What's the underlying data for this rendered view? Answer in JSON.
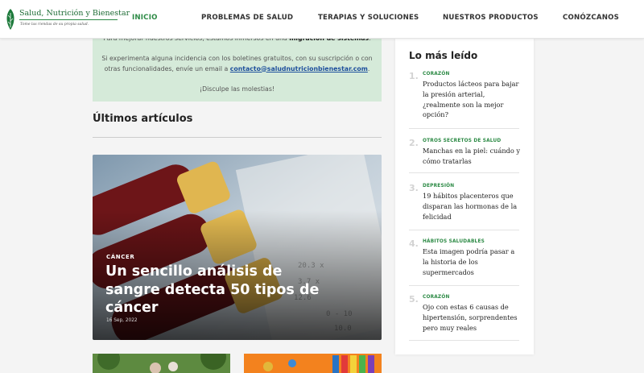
{
  "header": {
    "logo_title": "Salud, Nutrición y Bienestar",
    "logo_tagline": "Tome las riendas de su propia salud.",
    "nav": [
      {
        "label": "INICIO",
        "active": true
      },
      {
        "label": "PROBLEMAS DE SALUD",
        "active": false
      },
      {
        "label": "TERAPIAS Y SOLUCIONES",
        "active": false
      },
      {
        "label": "NUESTROS PRODUCTOS",
        "active": false
      },
      {
        "label": "CONÓZCANOS",
        "active": false
      }
    ]
  },
  "notice": {
    "line1_start": "Para mejorar nuestros servicios, estamos inmersos en una ",
    "line1_bold": "migración de sistemas",
    "line1_end": ".",
    "line2": "Si experimenta alguna incidencia con los boletines gratuitos, con su suscripción o con otras funcionalidades, envíe un email a ",
    "email": "contacto@saludnutricionbienestar.com",
    "line2_end": ".",
    "line3": "¡Disculpe las molestias!"
  },
  "latest": {
    "section_title": "Últimos artículos",
    "featured": {
      "category": "CÁNCER",
      "title": "Un sencillo análisis de sangre detecta 50 tipos de cáncer",
      "date": "16 Sep, 2022"
    }
  },
  "sidebar": {
    "title": "Lo más leído",
    "items": [
      {
        "num": "1.",
        "category": "CORAZÓN",
        "title": "Productos lácteos para bajar la presión arterial, ¿realmente son la mejor opción?"
      },
      {
        "num": "2.",
        "category": "OTROS SECRETOS DE SALUD",
        "title": "Manchas en la piel: cuándo y cómo tratarlas"
      },
      {
        "num": "3.",
        "category": "DEPRESIÓN",
        "title": "19 hábitos placenteros que disparan las hormonas de la felicidad"
      },
      {
        "num": "4.",
        "category": "HÁBITOS SALUDABLES",
        "title": "Esta imagen podría pasar a la historia de los supermercados"
      },
      {
        "num": "5.",
        "category": "CORAZÓN",
        "title": "Ojo con estas 6 causas de hipertensión, sorprendentes pero muy reales"
      }
    ]
  },
  "colors": {
    "accent": "#2c8a45",
    "notice_bg": "#d5ead9",
    "link": "#1d4f9c"
  }
}
